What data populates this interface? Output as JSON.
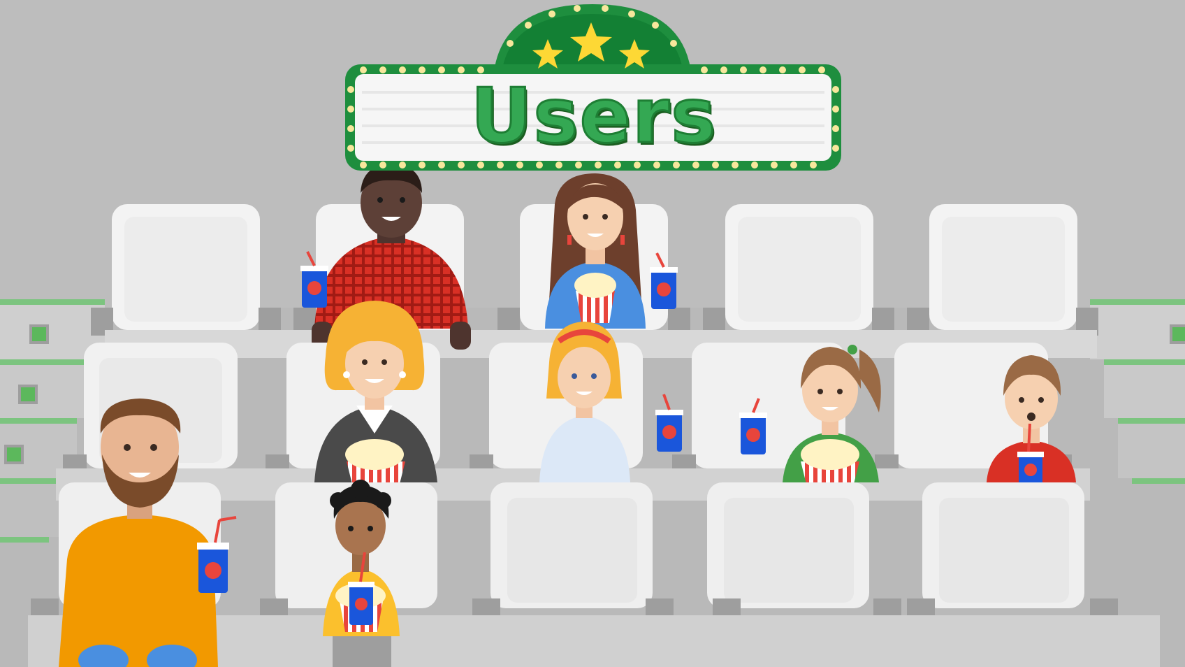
{
  "marquee": {
    "title": "Users",
    "stars": 3
  },
  "colors": {
    "background": "#b8b8b8",
    "marquee_green": "#1e8e3e",
    "marquee_text": "#34a853",
    "seat_white": "#f1f1f1",
    "seat_shadow": "#d6d6d6",
    "cup_blue": "#1a56db",
    "cup_red": "#e8453c"
  },
  "audience": [
    {
      "role": "adult-man-plaid-shirt"
    },
    {
      "role": "adult-woman-blue-shirt-popcorn"
    },
    {
      "role": "adult-woman-blazer-popcorn"
    },
    {
      "role": "girl-headband"
    },
    {
      "role": "girl-ponytail-popcorn"
    },
    {
      "role": "boy-red-shirt-drink"
    },
    {
      "role": "bearded-man-orange-shirt"
    },
    {
      "role": "boy-curly-hair-drink"
    }
  ]
}
